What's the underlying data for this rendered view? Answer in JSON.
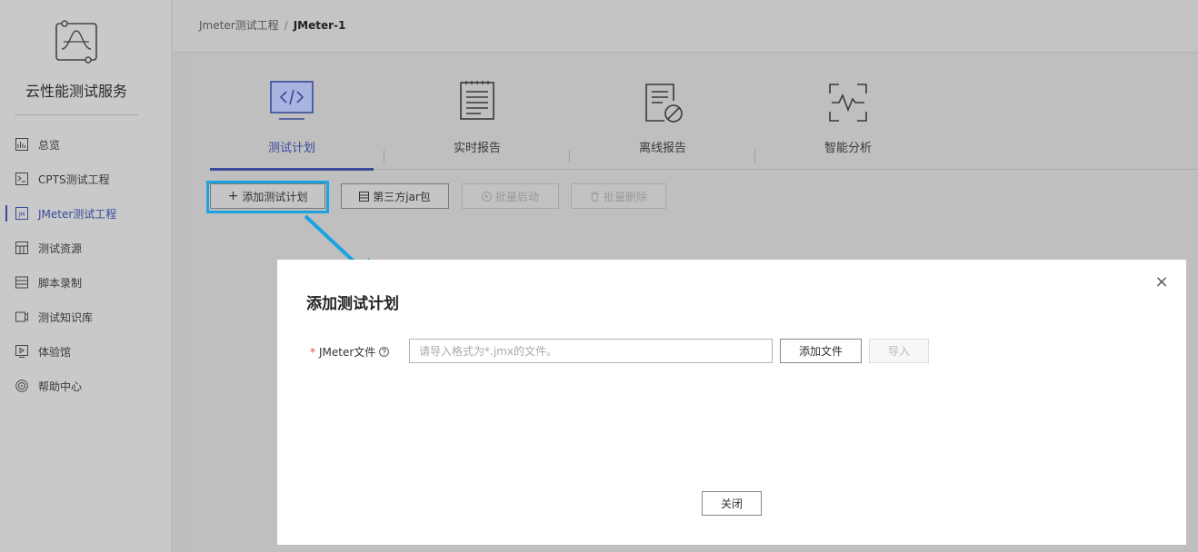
{
  "sidebar": {
    "brand": "云性能测试服务",
    "items": [
      {
        "label": "总览",
        "icon": "chart-icon"
      },
      {
        "label": "CPTS测试工程",
        "icon": "terminal-icon"
      },
      {
        "label": "JMeter测试工程",
        "icon": "jm-icon",
        "active": true
      },
      {
        "label": "测试资源",
        "icon": "resource-icon"
      },
      {
        "label": "脚本录制",
        "icon": "record-icon"
      },
      {
        "label": "测试知识库",
        "icon": "knowledge-icon"
      },
      {
        "label": "体验馆",
        "icon": "experience-icon"
      },
      {
        "label": "帮助中心",
        "icon": "help-center-icon"
      }
    ]
  },
  "breadcrumb": {
    "parent": "Jmeter测试工程",
    "separator": "/",
    "current": "JMeter-1"
  },
  "tabs": [
    {
      "label": "测试计划",
      "icon": "code-icon",
      "active": true
    },
    {
      "label": "实时报告",
      "icon": "report-icon"
    },
    {
      "label": "离线报告",
      "icon": "offline-report-icon"
    },
    {
      "label": "智能分析",
      "icon": "analysis-icon"
    }
  ],
  "toolbar": {
    "add_plan": "添加测试计划",
    "third_party_jar": "第三方jar包",
    "batch_start": "批量启动",
    "batch_delete": "批量删除"
  },
  "modal": {
    "title": "添加测试计划",
    "field_label": "JMeter文件",
    "required_mark": "*",
    "input_placeholder": "请导入格式为*.jmx的文件。",
    "input_value": "",
    "add_file_button": "添加文件",
    "import_button": "导入",
    "close_button": "关闭"
  },
  "colors": {
    "accent": "#3a4a9a",
    "highlight": "#1aa3e0",
    "required": "#e5484d"
  }
}
